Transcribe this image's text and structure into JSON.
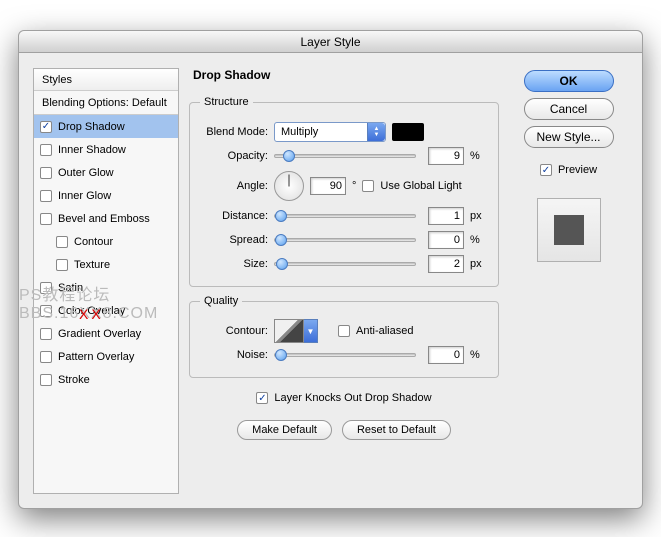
{
  "title": "Layer Style",
  "styles": {
    "header": "Styles",
    "blending_options": "Blending Options: Default",
    "items": [
      {
        "label": "Drop Shadow",
        "checked": true,
        "selected": true,
        "sub": false
      },
      {
        "label": "Inner Shadow",
        "checked": false,
        "selected": false,
        "sub": false
      },
      {
        "label": "Outer Glow",
        "checked": false,
        "selected": false,
        "sub": false
      },
      {
        "label": "Inner Glow",
        "checked": false,
        "selected": false,
        "sub": false
      },
      {
        "label": "Bevel and Emboss",
        "checked": false,
        "selected": false,
        "sub": false
      },
      {
        "label": "Contour",
        "checked": false,
        "selected": false,
        "sub": true
      },
      {
        "label": "Texture",
        "checked": false,
        "selected": false,
        "sub": true
      },
      {
        "label": "Satin",
        "checked": false,
        "selected": false,
        "sub": false
      },
      {
        "label": "Color Overlay",
        "checked": false,
        "selected": false,
        "sub": false
      },
      {
        "label": "Gradient Overlay",
        "checked": false,
        "selected": false,
        "sub": false
      },
      {
        "label": "Pattern Overlay",
        "checked": false,
        "selected": false,
        "sub": false
      },
      {
        "label": "Stroke",
        "checked": false,
        "selected": false,
        "sub": false
      }
    ]
  },
  "panel": {
    "title": "Drop Shadow",
    "structure": {
      "legend": "Structure",
      "blend_mode_label": "Blend Mode:",
      "blend_mode_value": "Multiply",
      "color": "#000000",
      "opacity_label": "Opacity:",
      "opacity_value": "9",
      "opacity_unit": "%",
      "angle_label": "Angle:",
      "angle_value": "90",
      "angle_unit": "°",
      "global_light_label": "Use Global Light",
      "global_light_checked": false,
      "distance_label": "Distance:",
      "distance_value": "1",
      "distance_unit": "px",
      "spread_label": "Spread:",
      "spread_value": "0",
      "spread_unit": "%",
      "size_label": "Size:",
      "size_value": "2",
      "size_unit": "px"
    },
    "quality": {
      "legend": "Quality",
      "contour_label": "Contour:",
      "anti_aliased_label": "Anti-aliased",
      "anti_aliased_checked": false,
      "noise_label": "Noise:",
      "noise_value": "0",
      "noise_unit": "%"
    },
    "knockout_label": "Layer Knocks Out Drop Shadow",
    "knockout_checked": true,
    "make_default": "Make Default",
    "reset_default": "Reset to Default"
  },
  "right": {
    "ok": "OK",
    "cancel": "Cancel",
    "new_style": "New Style...",
    "preview_label": "Preview",
    "preview_checked": true
  }
}
